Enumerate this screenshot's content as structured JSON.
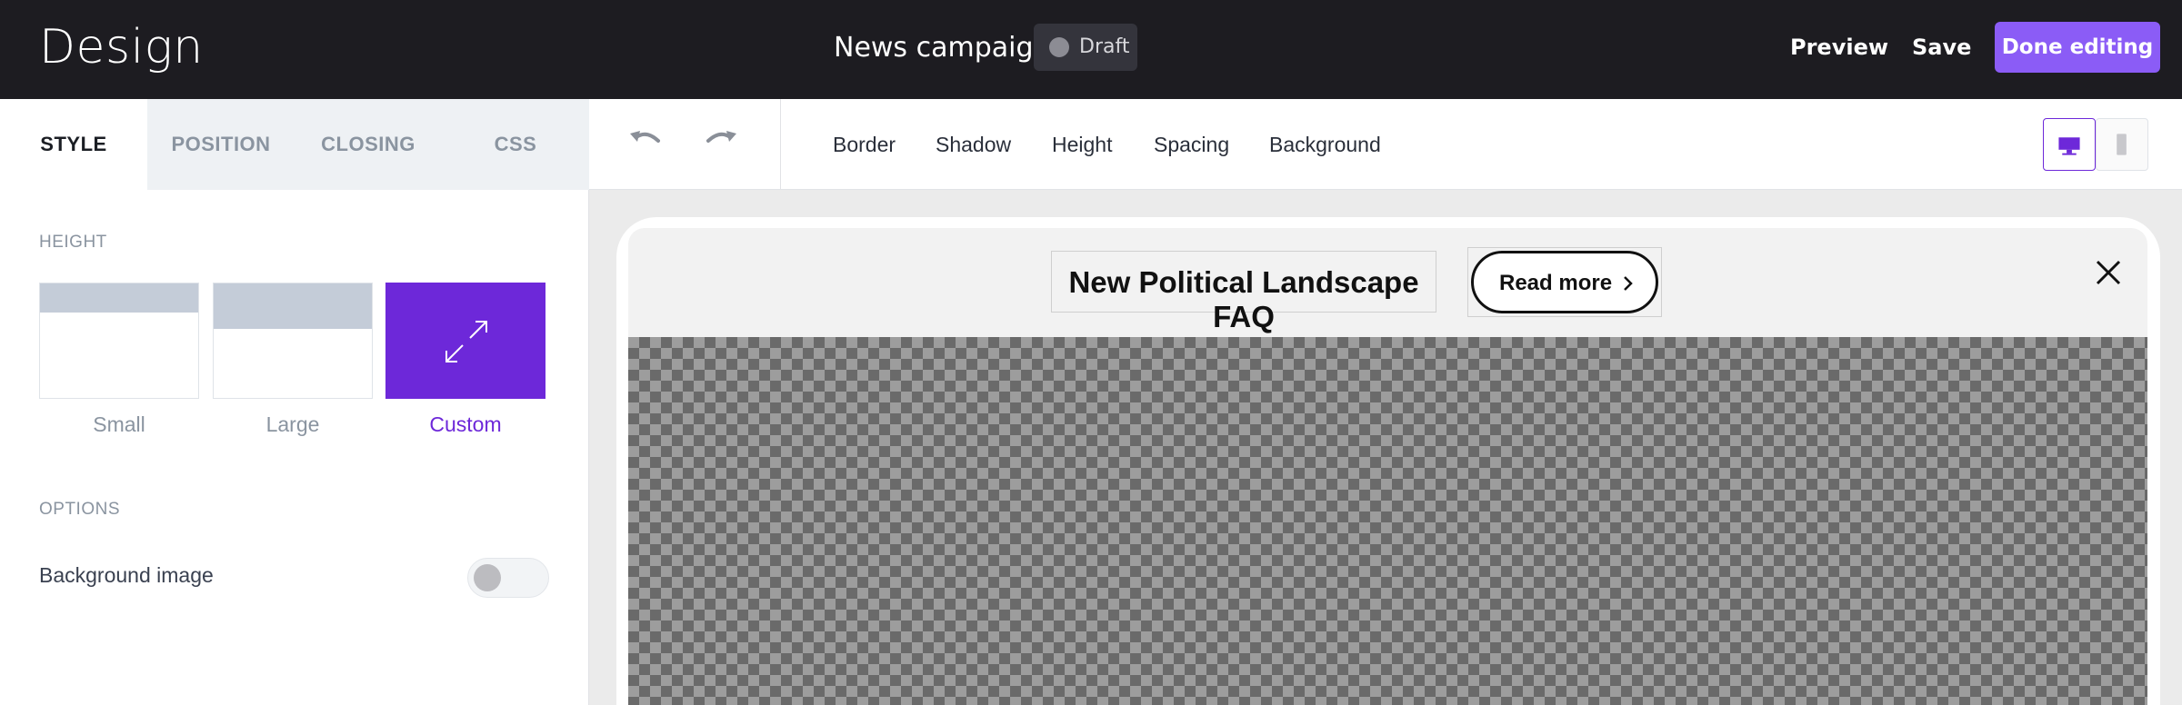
{
  "header": {
    "app_title": "Design",
    "campaign_name": "News campaign",
    "status": "Draft",
    "preview_label": "Preview",
    "save_label": "Save",
    "done_label": "Done editing"
  },
  "left_panel": {
    "tabs": [
      {
        "label": "STYLE",
        "active": true
      },
      {
        "label": "POSITION",
        "active": false
      },
      {
        "label": "CLOSING",
        "active": false
      },
      {
        "label": "CSS",
        "active": false
      }
    ],
    "height_section": {
      "label": "HEIGHT",
      "options": [
        {
          "label": "Small",
          "selected": false
        },
        {
          "label": "Large",
          "selected": false
        },
        {
          "label": "Custom",
          "selected": true,
          "icon": "expand-icon"
        }
      ]
    },
    "options_section": {
      "label": "OPTIONS",
      "background_image_label": "Background image",
      "background_image_enabled": false
    }
  },
  "toolbar": {
    "undo_icon": "undo-icon",
    "redo_icon": "redo-icon",
    "items": [
      "Border",
      "Shadow",
      "Height",
      "Spacing",
      "Background"
    ],
    "devices": [
      {
        "icon": "desktop-icon",
        "selected": true
      },
      {
        "icon": "mobile-icon",
        "selected": false
      }
    ]
  },
  "preview": {
    "headline": "New Political Landscape FAQ",
    "button_label": "Read more",
    "close_icon": "close-icon"
  },
  "colors": {
    "topbar_bg": "#1d1c21",
    "accent": "#8b5cf6",
    "selected_purple": "#6d28d9"
  }
}
